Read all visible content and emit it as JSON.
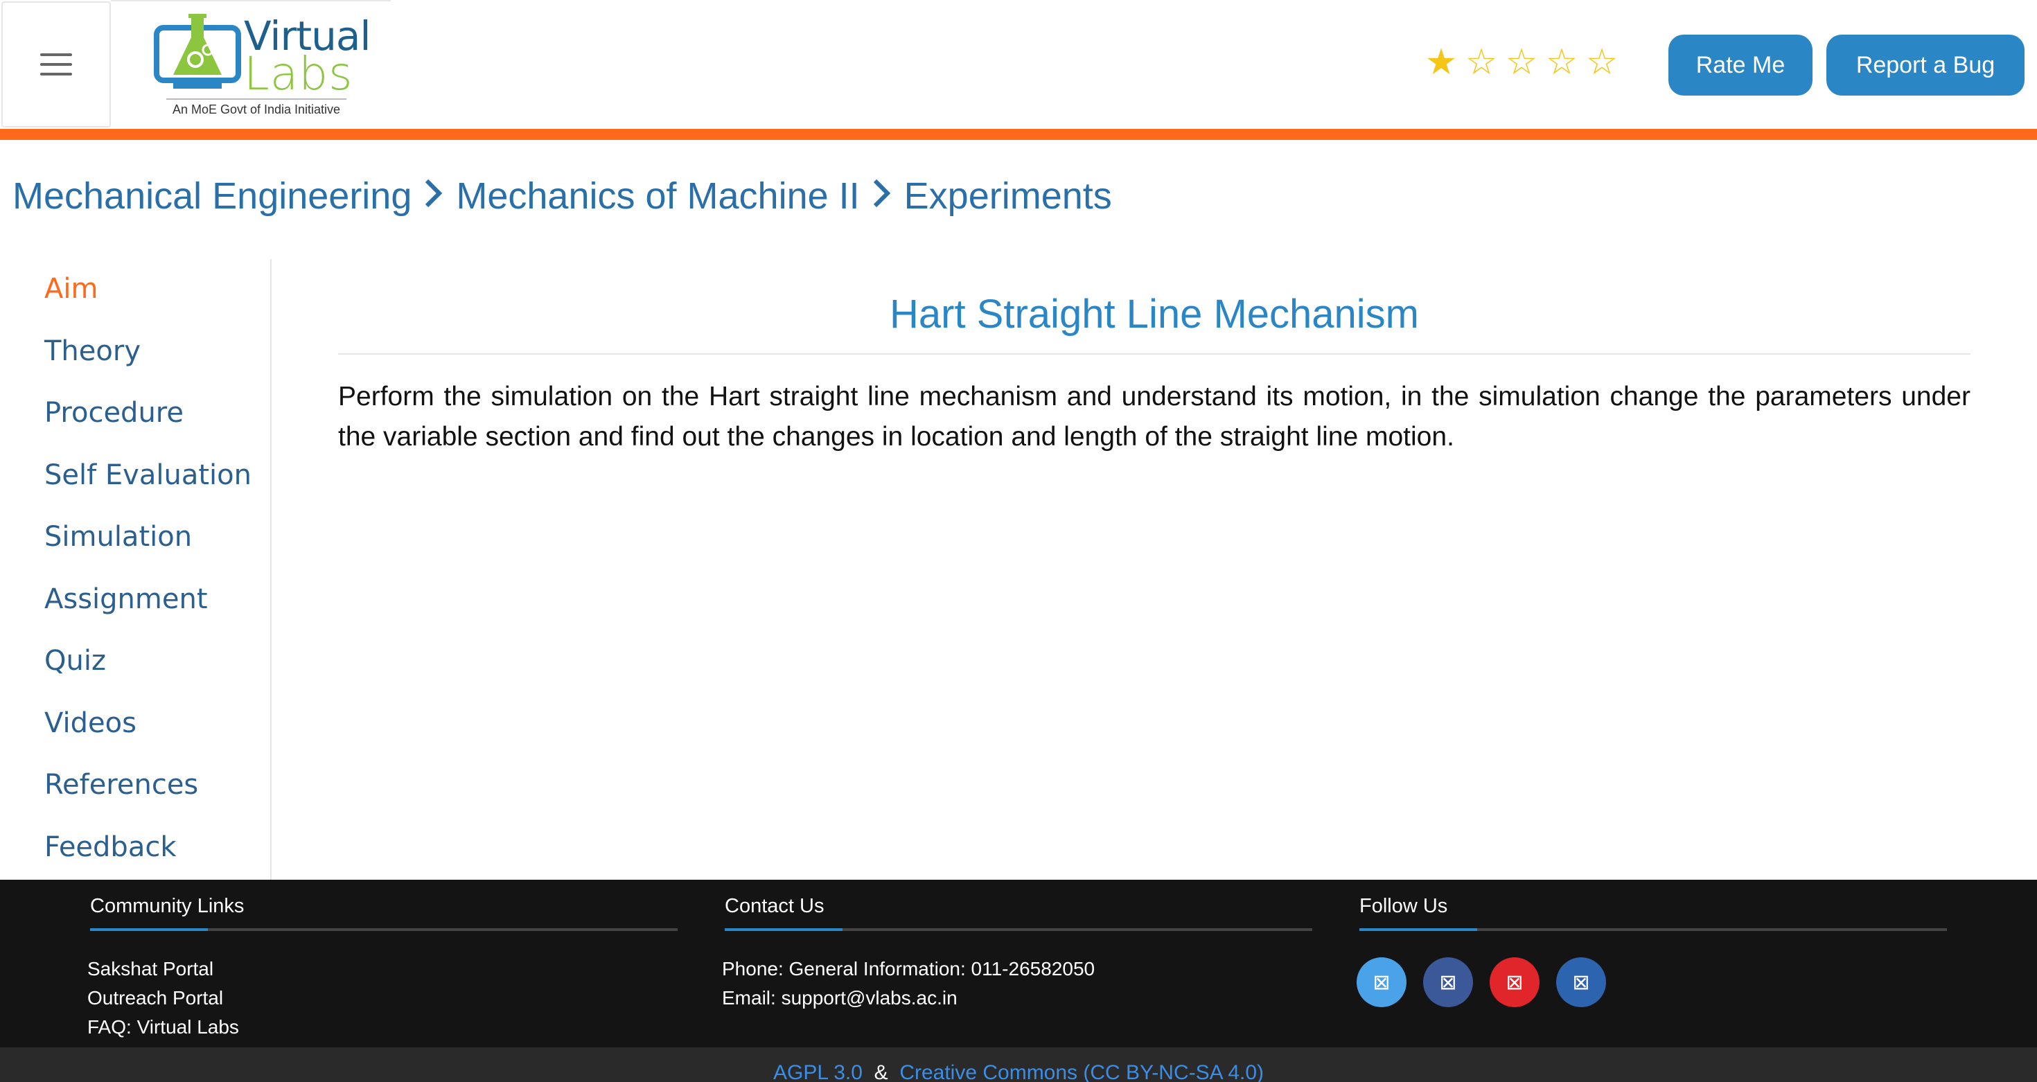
{
  "header": {
    "logo": {
      "word1": "Virtual",
      "word2": "Labs",
      "tagline": "An MoE Govt of India Initiative"
    },
    "rating": {
      "value": 1,
      "max": 5
    },
    "rate_button": "Rate Me",
    "bug_button": "Report a Bug"
  },
  "breadcrumb": {
    "items": [
      "Mechanical Engineering",
      "Mechanics of Machine II",
      "Experiments"
    ],
    "separator": ">"
  },
  "sidebar": {
    "items": [
      {
        "label": "Aim",
        "active": true
      },
      {
        "label": "Theory"
      },
      {
        "label": "Procedure"
      },
      {
        "label": "Self Evaluation"
      },
      {
        "label": "Simulation"
      },
      {
        "label": "Assignment"
      },
      {
        "label": "Quiz"
      },
      {
        "label": "Videos"
      },
      {
        "label": "References"
      },
      {
        "label": "Feedback"
      }
    ]
  },
  "main": {
    "title": "Hart Straight Line Mechanism",
    "text": "Perform the simulation on the Hart straight line mechanism and understand its motion, in the simulation change the parameters under the variable section and find out the changes in location and length of the straight line motion."
  },
  "footer": {
    "community": {
      "heading": "Community Links",
      "links": [
        "Sakshat Portal",
        "Outreach Portal",
        "FAQ: Virtual Labs"
      ]
    },
    "contact": {
      "heading": "Contact Us",
      "lines": [
        "Phone: General Information: 011-26582050",
        "Email: support@vlabs.ac.in"
      ]
    },
    "follow": {
      "heading": "Follow Us",
      "icons": [
        {
          "name": "twitter-icon",
          "color": "#4aa3e8"
        },
        {
          "name": "facebook-icon",
          "color": "#3b5998"
        },
        {
          "name": "youtube-icon",
          "color": "#e0262a"
        },
        {
          "name": "linkedin-icon",
          "color": "#2d64b0"
        }
      ]
    },
    "license_1": "AGPL 3.0",
    "license_and": "&",
    "license_2": "Creative Commons (CC BY-NC-SA 4.0)"
  },
  "colors": {
    "accent_orange": "#ff6a1a",
    "brand_blue": "#2b86c5",
    "footer_bg": "#141414"
  }
}
